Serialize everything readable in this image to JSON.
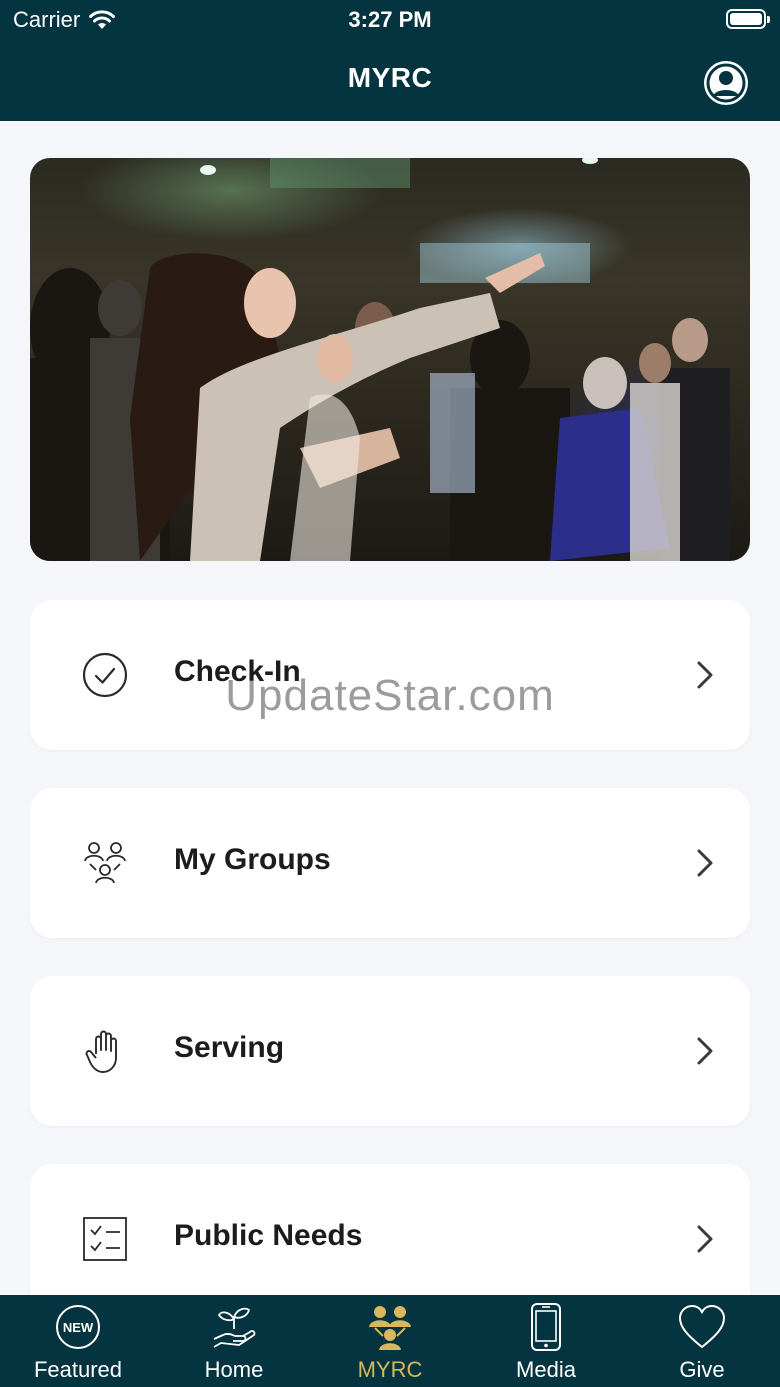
{
  "status_bar": {
    "carrier": "Carrier",
    "time": "3:27 PM"
  },
  "nav": {
    "title": "MYRC",
    "profile_icon": "profile-icon"
  },
  "hero": {
    "description_icon": "worship-photo"
  },
  "menu": [
    {
      "label": "Check-In",
      "icon": "check-circle-icon"
    },
    {
      "label": "My Groups",
      "icon": "groups-icon"
    },
    {
      "label": "Serving",
      "icon": "raised-hand-icon"
    },
    {
      "label": "Public Needs",
      "icon": "checklist-icon"
    }
  ],
  "watermark": "UpdateStar.com",
  "tabs": [
    {
      "label": "Featured",
      "icon": "new-badge-icon",
      "badge": "NEW",
      "active": false
    },
    {
      "label": "Home",
      "icon": "hand-plant-icon",
      "active": false
    },
    {
      "label": "MYRC",
      "icon": "people-icon",
      "active": true
    },
    {
      "label": "Media",
      "icon": "phone-icon",
      "active": false
    },
    {
      "label": "Give",
      "icon": "heart-icon",
      "active": false
    }
  ],
  "colors": {
    "primary": "#03343f",
    "active_tab": "#d9b75a",
    "background": "#f4f6f9"
  }
}
